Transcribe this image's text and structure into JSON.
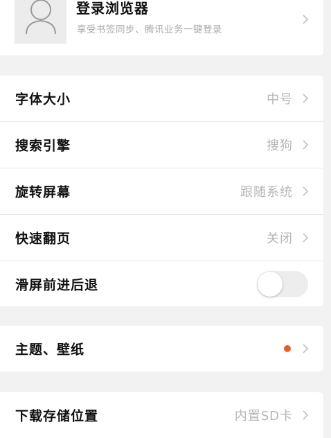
{
  "login": {
    "title": "登录浏览器",
    "subtitle": "享受书签同步、腾讯业务一键登录",
    "avatar_icon": "user-outline-icon"
  },
  "settings": [
    {
      "label": "字体大小",
      "value": "中号"
    },
    {
      "label": "搜索引擎",
      "value": "搜狗"
    },
    {
      "label": "旋转屏幕",
      "value": "跟随系统"
    },
    {
      "label": "快速翻页",
      "value": "关闭"
    },
    {
      "label": "滑屏前进后退",
      "toggle_on": false
    }
  ],
  "theme": {
    "label": "主题、壁纸",
    "dot_color": "#ef5a2a"
  },
  "storage": {
    "label": "下载存储位置",
    "value": "内置SD卡"
  },
  "colors": {
    "background": "#f2f2f2",
    "card": "#ffffff",
    "value_text": "#b6b6b6",
    "accent_dot": "#ef5a2a"
  }
}
